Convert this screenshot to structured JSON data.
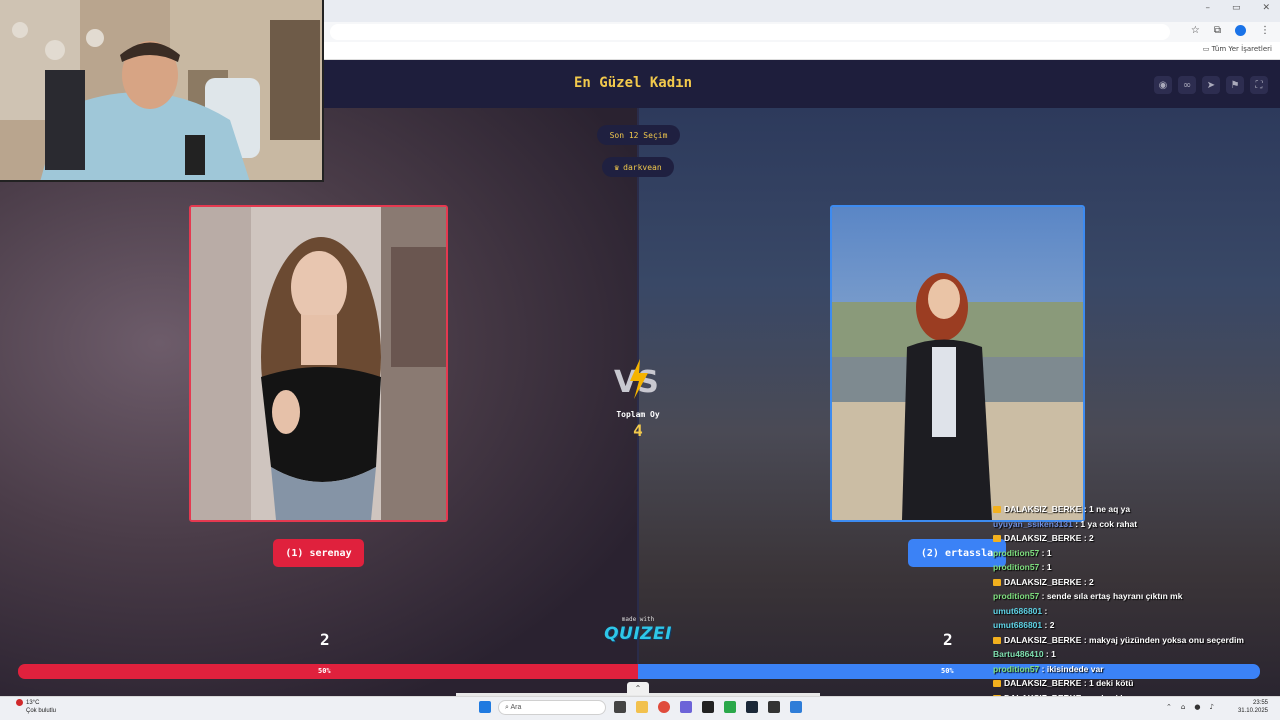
{
  "browser": {
    "bookmarks_label": "Tüm Yer İşaretleri",
    "window_controls": [
      "–",
      "▭",
      "✕"
    ]
  },
  "quiz": {
    "title": "En Güzel Kadın",
    "round_pill": "Son 12 Seçim",
    "user_pill": "darkvean",
    "user_icon": "crown-icon",
    "header_icons": [
      "eye-icon",
      "link-icon",
      "send-icon",
      "flag-icon",
      "fullscreen-icon"
    ]
  },
  "contestants": {
    "left": {
      "button_label": "(1) serenay",
      "score": "2",
      "percent": "50%",
      "color": "#e0213d"
    },
    "right": {
      "button_label": "(2) ertassla",
      "score": "2",
      "percent": "50%",
      "color": "#3b82f6"
    }
  },
  "vs": {
    "total_label": "Toplam Oy",
    "total_value": "4"
  },
  "footer": {
    "made_with": "made with",
    "brand": "QUIZEI"
  },
  "chat": [
    {
      "user": "DALAKSIZ_BERKE",
      "msg": " : 1 ne aq ya",
      "color": "#ffffff",
      "badge": true
    },
    {
      "user": "uyuyan_ssiken3131",
      "msg": " : 1 ya cok rahat",
      "color": "#6f8fdf",
      "badge": false
    },
    {
      "user": "DALAKSIZ_BERKE",
      "msg": " : 2",
      "color": "#ffffff",
      "badge": true
    },
    {
      "user": "prodition57",
      "msg": " : 1",
      "color": "#7fe07f",
      "badge": false
    },
    {
      "user": "prodition57",
      "msg": " : 1",
      "color": "#7fe07f",
      "badge": false
    },
    {
      "user": "DALAKSIZ_BERKE",
      "msg": " : 2",
      "color": "#ffffff",
      "badge": true
    },
    {
      "user": "prodition57",
      "msg": " : sende sıla ertaş hayranı çıktın mk",
      "color": "#7fe07f",
      "badge": false
    },
    {
      "user": "umut686801",
      "msg": " : ",
      "color": "#5fd3e6",
      "badge": false
    },
    {
      "user": "umut686801",
      "msg": " : 2",
      "color": "#5fd3e6",
      "badge": false
    },
    {
      "user": "DALAKSIZ_BERKE",
      "msg": " : makyaj yüzünden yoksa onu seçerdim",
      "color": "#ffffff",
      "badge": true
    },
    {
      "user": "Bartu486410",
      "msg": " : 1",
      "color": "#7fe0b0",
      "badge": false
    },
    {
      "user": "prodition57",
      "msg": " : ikisindede var",
      "color": "#7fe07f",
      "badge": false
    },
    {
      "user": "DALAKSIZ_BERKE",
      "msg": " : 1 deki kötü",
      "color": "#ffffff",
      "badge": true
    },
    {
      "user": "DALAKSIZ_BERKE",
      "msg": " : makyaj boya",
      "color": "#ffffff",
      "badge": true
    }
  ],
  "taskbar": {
    "weather_temp": "13°C",
    "weather_desc": "Çok bulutlu",
    "search_placeholder": "Ara",
    "time": "23:55",
    "date": "31.10.2025"
  }
}
